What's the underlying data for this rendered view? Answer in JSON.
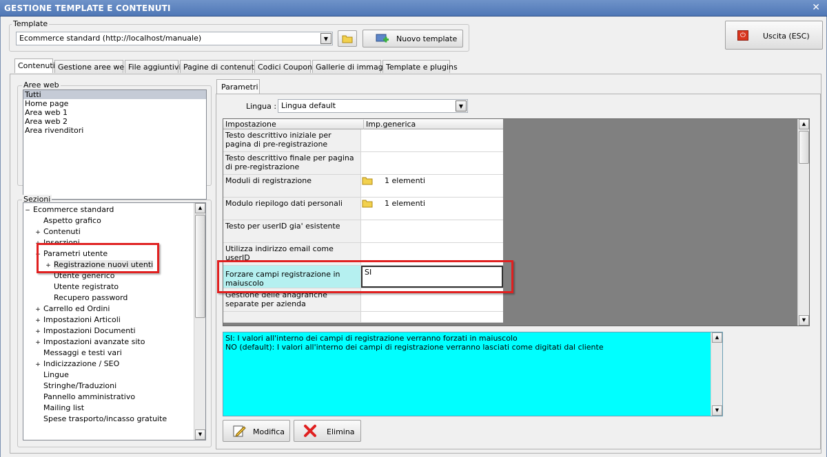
{
  "window": {
    "title": "GESTIONE TEMPLATE E CONTENUTI",
    "close": "✕"
  },
  "template": {
    "label": "Template",
    "value": "Ecommerce standard (http://localhost/manuale)",
    "new_label": "Nuovo template"
  },
  "exit_label": "Uscita (ESC)",
  "tabs": [
    "Contenuti",
    "Gestione aree web",
    "File aggiuntivi",
    "Pagine di contenuti",
    "Codici Coupon",
    "Gallerie di immagini",
    "Template e plugins"
  ],
  "aree": {
    "label": "Aree web",
    "items": [
      "Tutti",
      "Home page",
      "Area web 1",
      "Area web 2",
      "Area rivenditori"
    ]
  },
  "sezioni": {
    "label": "Sezioni",
    "nodes": [
      {
        "label": "Ecommerce standard",
        "sign": "−"
      },
      {
        "label": "Aspetto grafico",
        "sign": ""
      },
      {
        "label": "Contenuti",
        "sign": "+"
      },
      {
        "label": "Inserzioni",
        "sign": "+"
      },
      {
        "label": "Parametri utente",
        "sign": "−"
      },
      {
        "label": "Registrazione nuovi utenti",
        "sign": "+"
      },
      {
        "label": "Utente generico",
        "sign": ""
      },
      {
        "label": "Utente registrato",
        "sign": ""
      },
      {
        "label": "Recupero password",
        "sign": ""
      },
      {
        "label": "Carrello ed Ordini",
        "sign": "+"
      },
      {
        "label": "Impostazioni Articoli",
        "sign": "+"
      },
      {
        "label": "Impostazioni Documenti",
        "sign": "+"
      },
      {
        "label": "Impostazioni avanzate sito",
        "sign": "+"
      },
      {
        "label": "Messaggi e testi vari",
        "sign": ""
      },
      {
        "label": "Indicizzazione / SEO",
        "sign": "+"
      },
      {
        "label": "Lingue",
        "sign": ""
      },
      {
        "label": "Stringhe/Traduzioni",
        "sign": ""
      },
      {
        "label": "Pannello amministrativo",
        "sign": ""
      },
      {
        "label": "Mailing list",
        "sign": ""
      },
      {
        "label": "Spese trasporto/incasso gratuite",
        "sign": ""
      }
    ]
  },
  "parametri": {
    "tab": "Parametri",
    "lingua_label": "Lingua :",
    "lingua_value": "Lingua default",
    "headers": [
      "Impostazione",
      "Imp.generica"
    ],
    "rows": [
      {
        "name": "Testo descrittivo iniziale per pagina di pre-registrazione",
        "value": ""
      },
      {
        "name": "Testo descrittivo finale per pagina di pre-registrazione",
        "value": ""
      },
      {
        "name": "Moduli di registrazione",
        "value": "1 elementi"
      },
      {
        "name": "Modulo riepilogo dati personali",
        "value": "1 elementi"
      },
      {
        "name": "Testo per userID gia' esistente",
        "value": ""
      },
      {
        "name": "Utilizza indirizzo email come userID",
        "value": ""
      },
      {
        "name": "Forzare campi registrazione in maiuscolo",
        "value": "SI"
      },
      {
        "name": "Gestione delle anagrafiche separate per azienda",
        "value": ""
      }
    ]
  },
  "description": {
    "line1": "SI: I valori all'interno dei campi di registrazione verranno forzati in maiuscolo",
    "line2": "NO (default):  I valori all'interno dei campi di registrazione verranno lasciati come digitati dal cliente"
  },
  "actions": {
    "modify": "Modifica",
    "delete": "Elimina"
  },
  "colors": {
    "title_bar": "#5b82bf",
    "selected_cell": "#b5f0f0",
    "description_bg": "#00ffff",
    "highlight_border": "#e02020"
  }
}
